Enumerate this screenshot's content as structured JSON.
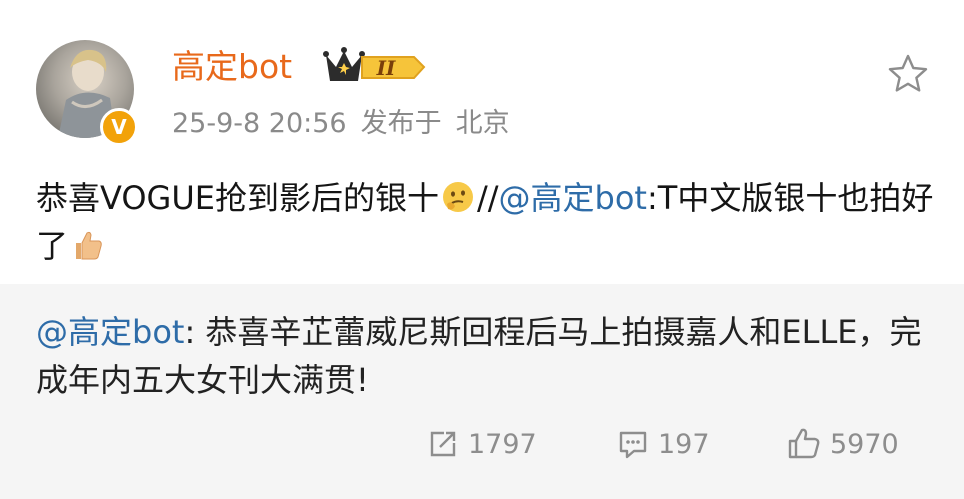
{
  "post": {
    "username": "高定bot",
    "badge_level": "II",
    "timestamp": "25-9-8 20:56",
    "location_prefix": "发布于",
    "location": "北京",
    "text_before_emoji": "恭喜VOGUE抢到影后的银十",
    "emoji_1": "thinking-face",
    "text_forward": "//",
    "mention": "@高定bot",
    "text_after_mention": ":T中文版银十也拍好了",
    "emoji_2": "thumbs-up"
  },
  "repost": {
    "mention": "@高定bot",
    "text": ": 恭喜辛芷蕾威尼斯回程后马上拍摄嘉人和ELLE，完成年内五大女刊大满贯!"
  },
  "actions": {
    "repost_count": "1797",
    "comment_count": "197",
    "like_count": "5970"
  },
  "colors": {
    "username": "#e8691b",
    "mention": "#2e6ca8",
    "meta": "#8a8a8a",
    "repost_bg": "#f5f5f5"
  }
}
